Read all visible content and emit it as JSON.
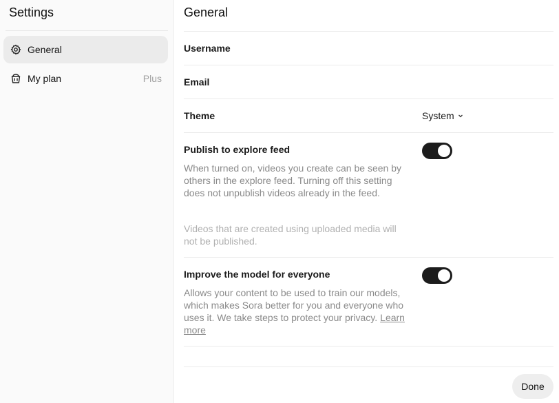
{
  "sidebar": {
    "title": "Settings",
    "items": [
      {
        "label": "General",
        "icon": "gear-icon",
        "active": true
      },
      {
        "label": "My plan",
        "icon": "bucket-icon",
        "badge": "Plus"
      }
    ]
  },
  "main": {
    "title": "General",
    "username_label": "Username",
    "email_label": "Email",
    "theme_label": "Theme",
    "theme_value": "System",
    "publish": {
      "label": "Publish to explore feed",
      "description": "When turned on, videos you create can be seen by others in the explore feed. Turning off this setting does not unpublish videos already in the feed.",
      "note": "Videos that are created using uploaded media will not be published.",
      "enabled": true
    },
    "improve": {
      "label": "Improve the model for everyone",
      "description": "Allows your content to be used to train our models, which makes Sora better for you and everyone who uses it. We take steps to protect your privacy.",
      "link": "Learn more",
      "enabled": true
    },
    "done_label": "Done"
  }
}
